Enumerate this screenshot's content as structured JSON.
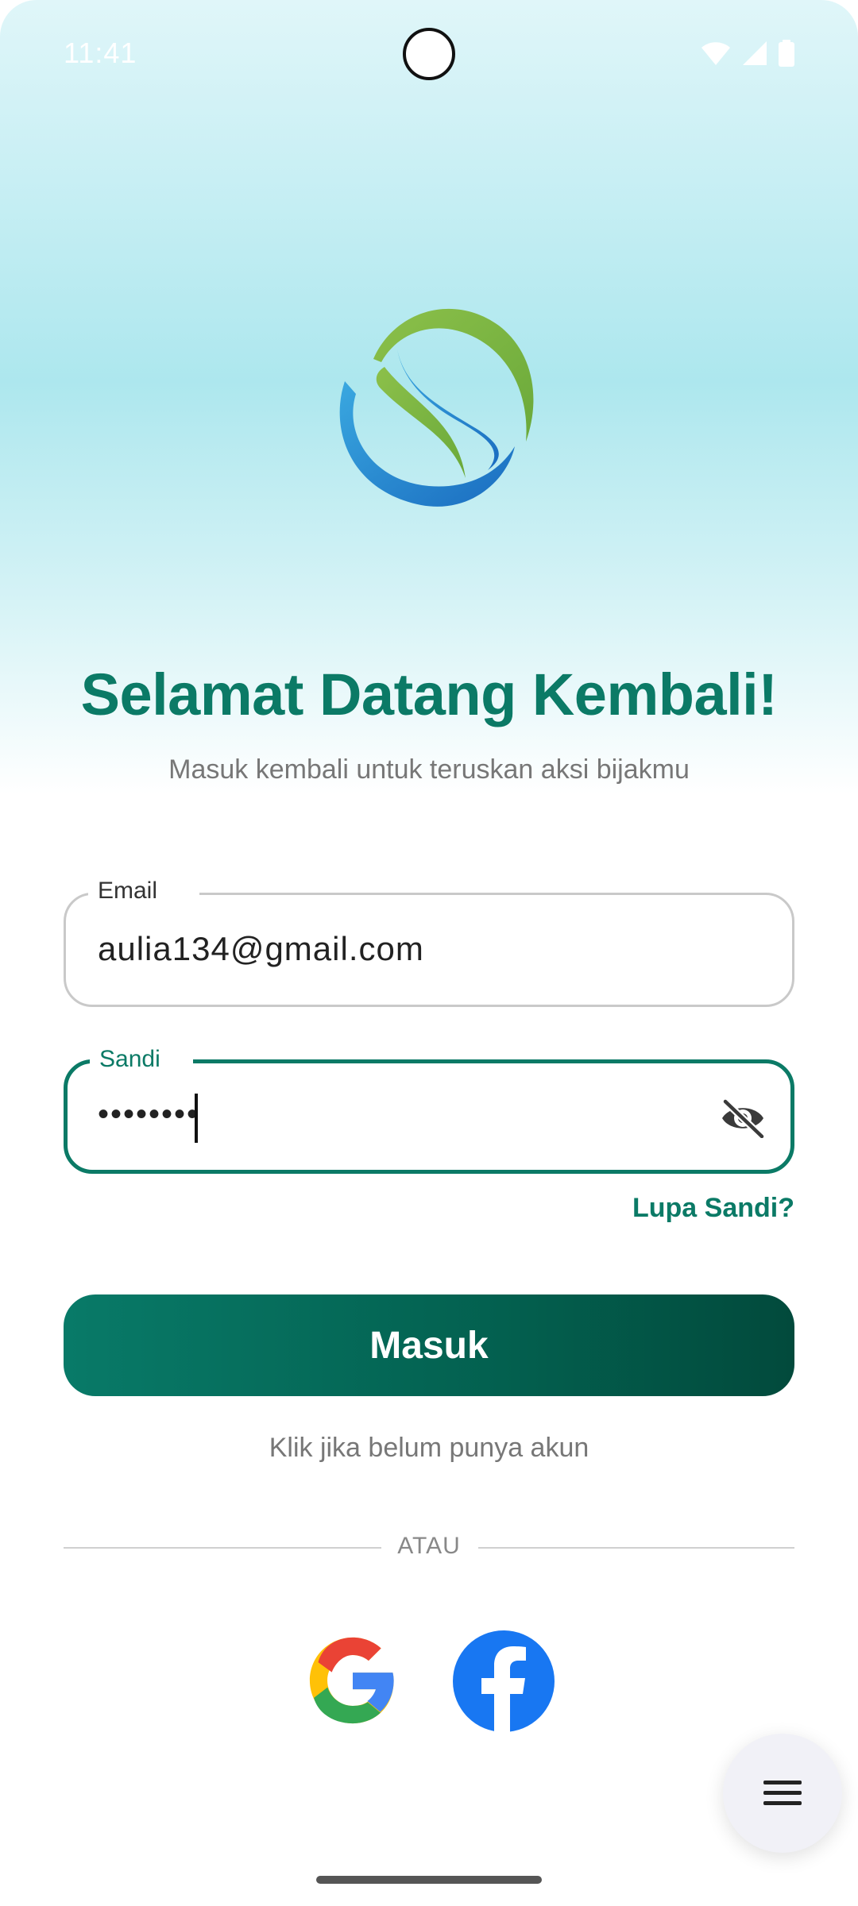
{
  "status_bar": {
    "time": "11:41"
  },
  "header": {
    "title": "Selamat Datang Kembali!",
    "subtitle": "Masuk kembali untuk teruskan aksi bijakmu"
  },
  "form": {
    "email": {
      "label": "Email",
      "value": "aulia134@gmail.com"
    },
    "password": {
      "label": "Sandi",
      "value": "••••••••"
    },
    "forgot_label": "Lupa Sandi?",
    "submit_label": "Masuk",
    "register_label": "Klik jika belum punya akun"
  },
  "divider": {
    "label": "ATAU"
  },
  "social": [
    "google",
    "facebook"
  ],
  "icons": {
    "logo": "s-leaf-logo",
    "wifi": "wifi-icon",
    "signal": "signal-icon",
    "battery": "battery-icon",
    "visibility": "eye-off-icon",
    "menu": "menu-icon"
  },
  "colors": {
    "accent": "#0b7a66",
    "button_start": "#087a68",
    "button_end": "#024a3c",
    "facebook": "#1877f2"
  }
}
